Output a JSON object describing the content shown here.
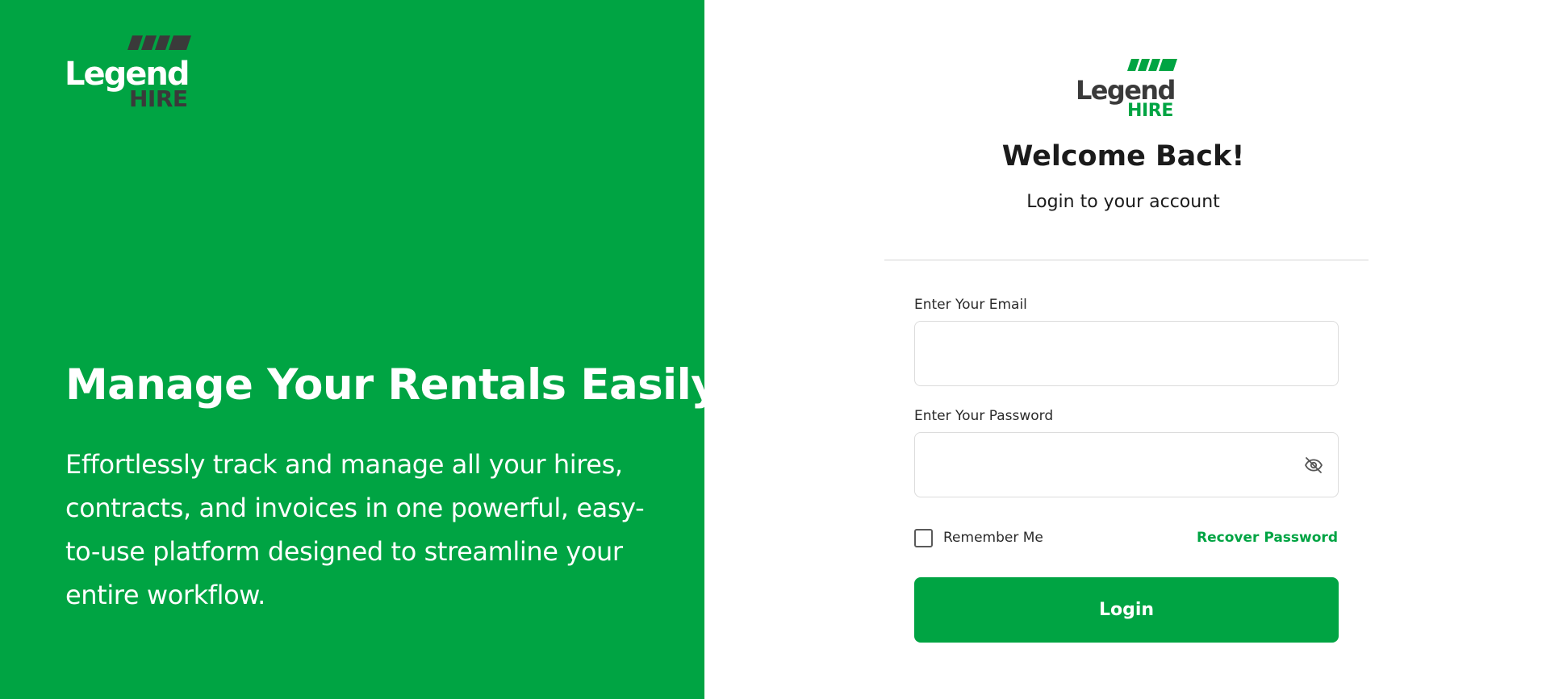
{
  "brand": {
    "logo_word": "Legend",
    "logo_sub": "HIRE",
    "primary_color": "#00a443",
    "logo_dark_color": "#3a3a3a"
  },
  "hero": {
    "title": "Manage Your Rentals Easily",
    "description": "Effortlessly track and manage all your hires, contracts, and invoices in one powerful, easy-to-use platform designed to streamline your entire workflow."
  },
  "login": {
    "heading": "Welcome Back!",
    "subheading": "Login to your account",
    "email_label": "Enter Your Email",
    "email_value": "",
    "password_label": "Enter Your Password",
    "password_value": "",
    "password_toggle_icon": "eye-off-icon",
    "remember_label": "Remember Me",
    "remember_checked": false,
    "recover_label": "Recover Password",
    "submit_label": "Login"
  }
}
